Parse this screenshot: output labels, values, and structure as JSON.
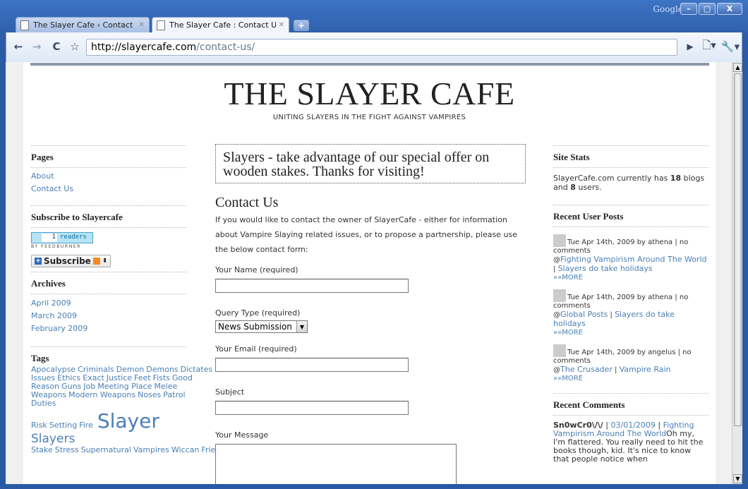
{
  "browser": {
    "window_label": "Google",
    "tabs": [
      {
        "title": "The Slayer Cafe › Contact ...",
        "active": false
      },
      {
        "title": "The Slayer Cafe : Contact Us",
        "active": true
      }
    ],
    "new_tab_label": "+",
    "url_host": "http://slayercafe.com",
    "url_path": "/contact-us/",
    "window_buttons": {
      "min": "–",
      "max": "□",
      "close": "X"
    }
  },
  "site": {
    "title": "THE SLAYER CAFE",
    "tagline": "UNITING SLAYERS IN THE FIGHT AGAINST VAMPIRES"
  },
  "left": {
    "pages_title": "Pages",
    "pages": [
      "About",
      "Contact Us"
    ],
    "subscribe_title": "Subscribe to Slayercafe",
    "feed_count": "1",
    "feed_label": "readers",
    "feed_by": "BY FEEDBURNER",
    "subscribe_button": "Subscribe",
    "archives_title": "Archives",
    "archives": [
      "April 2009",
      "March 2009",
      "February 2009"
    ],
    "tags_title": "Tags",
    "tags_line1": [
      "Apocalypse",
      "Criminals",
      "Demon",
      "Demons",
      "Dictates",
      "Ethical Issues",
      "Ethics",
      "Exact",
      "Justice",
      "Feet",
      "Fists",
      "Good Reason",
      "Guns",
      "Job",
      "Meeting Place",
      "Melee Weapons",
      "Modern Weapons",
      "Noses",
      "Patrol Duties"
    ],
    "tags_risk": [
      "Risk",
      "Setting",
      "Fire"
    ],
    "tag_big": "Slayer",
    "tag_mid": "Slayers",
    "tags_line3": [
      "Stake",
      "Stress",
      "Supernatural",
      "Vampires",
      "Wiccan",
      "Friends"
    ]
  },
  "main": {
    "promo": "Slayers - take advantage of our special offer on wooden stakes. Thanks for visiting!",
    "heading": "Contact Us",
    "intro": "If you would like to contact the owner of SlayerCafe - either for information about Vampire Slaying related issues, or to propose a partnership, please use the below contact form:",
    "name_label": "Your Name (required)",
    "query_label": "Query Type (required)",
    "query_value": "News Submission",
    "email_label": "Your Email (required)",
    "subject_label": "Subject",
    "message_label": "Your Message"
  },
  "right": {
    "stats_title": "Site Stats",
    "stats_pre": "SlayerCafe.com currently has ",
    "stats_blogs": "18",
    "stats_mid": " blogs and ",
    "stats_users": "8",
    "stats_post": " users.",
    "posts_title": "Recent User Posts",
    "posts": [
      {
        "meta": "Tue Apr 14th, 2009 by athena | no comments",
        "cat": "Fighting Vampirism Around The World",
        "title": "Slayers do take holidays",
        "more": "»»MORE"
      },
      {
        "meta": "Tue Apr 14th, 2009 by athena | no comments",
        "cat": "Global Posts",
        "title": "Slayers do take holidays",
        "more": "»»MORE"
      },
      {
        "meta": "Tue Apr 14th, 2009 by angelus | no comments",
        "cat": "The Crusader",
        "title": "Vampire Rain",
        "more": "»»MORE"
      }
    ],
    "comments_title": "Recent Comments",
    "comment_author": "Sn0wCr0\\/\\/",
    "comment_date": "03/01/2009",
    "comment_link": "Fighting Vampirism Around The World",
    "comment_text": "Oh my, I'm flattered. You really need to hit the books though, kid. It's nice to know that people notice when"
  }
}
